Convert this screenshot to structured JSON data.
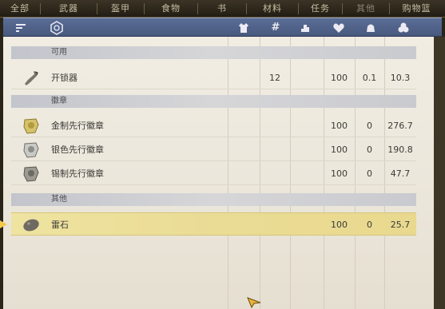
{
  "tabs": [
    {
      "label": "全部",
      "state": "normal"
    },
    {
      "label": "武器",
      "state": "normal"
    },
    {
      "label": "盔甲",
      "state": "normal"
    },
    {
      "label": "食物",
      "state": "normal"
    },
    {
      "label": "书",
      "state": "normal"
    },
    {
      "label": "材料",
      "state": "normal"
    },
    {
      "label": "任务",
      "state": "normal"
    },
    {
      "label": "其他",
      "state": "muted"
    },
    {
      "label": "购物篮",
      "state": "normal"
    }
  ],
  "header_icons": [
    "filter-icon",
    "category-icon",
    "clothing-icon",
    "hash-icon",
    "weight-icon",
    "durability-icon",
    "quality-icon",
    "price-icon"
  ],
  "sections": [
    {
      "title": "可用",
      "items": [
        {
          "name": "开锁器",
          "icon": "lockpick-icon",
          "count": "12",
          "durability": "100",
          "weight": "0.1",
          "price": "10.3",
          "selected": false
        }
      ]
    },
    {
      "title": "徽章",
      "items": [
        {
          "name": "金制先行徽章",
          "icon": "gold-badge-icon",
          "count": "",
          "durability": "100",
          "weight": "0",
          "price": "276.7",
          "selected": false
        },
        {
          "name": "银色先行徽章",
          "icon": "silver-badge-icon",
          "count": "",
          "durability": "100",
          "weight": "0",
          "price": "190.8",
          "selected": false
        },
        {
          "name": "锡制先行徽章",
          "icon": "tin-badge-icon",
          "count": "",
          "durability": "100",
          "weight": "0",
          "price": "47.7",
          "selected": false
        }
      ]
    },
    {
      "title": "其他",
      "items": [
        {
          "name": "雷石",
          "icon": "thunderstone-icon",
          "count": "",
          "durability": "100",
          "weight": "0",
          "price": "25.7",
          "selected": true
        }
      ]
    }
  ]
}
